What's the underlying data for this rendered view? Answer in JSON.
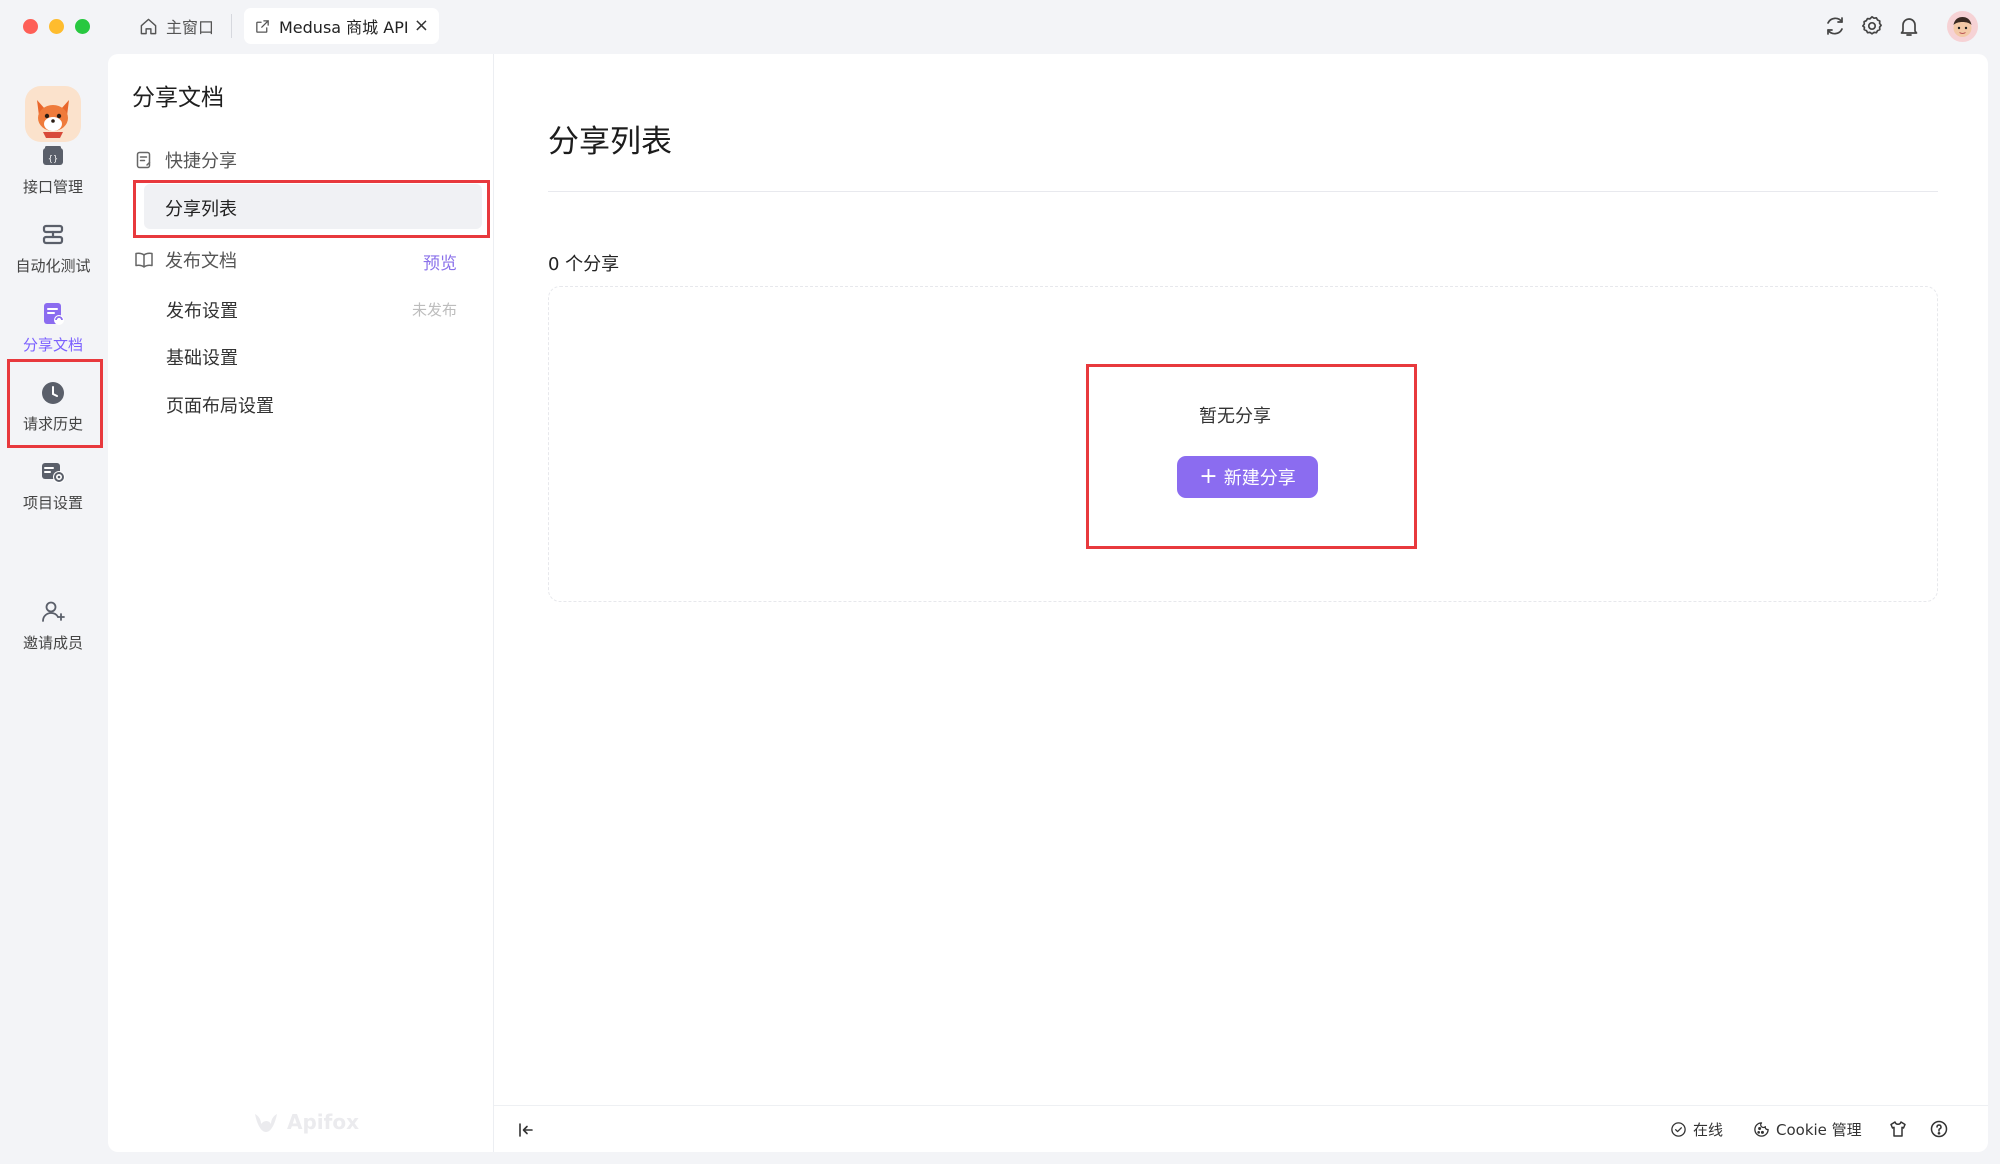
{
  "titlebar": {
    "home_tab": "主窗口",
    "project_tab": "Medusa 商城 API",
    "close_glyph": "×"
  },
  "rail": {
    "items": [
      {
        "label": "接口管理",
        "icon": "api-icon"
      },
      {
        "label": "自动化测试",
        "icon": "automation-icon"
      },
      {
        "label": "分享文档",
        "icon": "share-doc-icon"
      },
      {
        "label": "请求历史",
        "icon": "history-icon"
      },
      {
        "label": "项目设置",
        "icon": "settings-icon"
      },
      {
        "label": "邀请成员",
        "icon": "invite-icon"
      }
    ],
    "active_index": 2
  },
  "subnav": {
    "title": "分享文档",
    "quick_share": "快捷分享",
    "share_list": "分享列表",
    "publish_doc": "发布文档",
    "preview": "预览",
    "publish_settings": "发布设置",
    "unpublished": "未发布",
    "basic_settings": "基础设置",
    "layout_settings": "页面布局设置",
    "watermark": "Apifox"
  },
  "main": {
    "title": "分享列表",
    "count_label": "0 个分享",
    "empty_text": "暂无分享",
    "new_button_plus": "+",
    "new_button": "新建分享"
  },
  "footer": {
    "online": "在线",
    "cookie": "Cookie 管理"
  },
  "colors": {
    "accent": "#8b6cf0",
    "highlight_box": "#e8393d",
    "background": "#f3f4f7"
  }
}
